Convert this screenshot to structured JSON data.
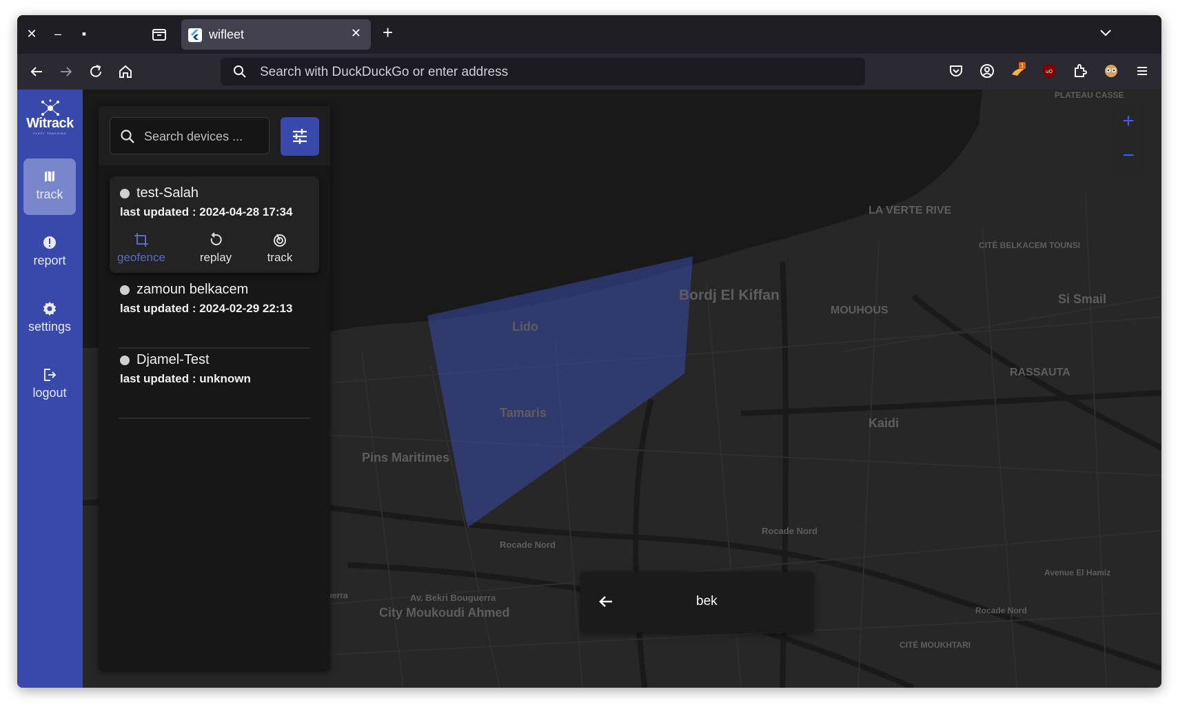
{
  "browser": {
    "tab_title": "wifleet",
    "url_placeholder": "Search with DuckDuckGo or enter address",
    "extension_badge": "1"
  },
  "sidebar": {
    "logo_word": "Witrack",
    "logo_tagline": "FLEET TRACKING",
    "items": [
      {
        "label": "track",
        "icon": "map-icon",
        "active": true
      },
      {
        "label": "report",
        "icon": "alert-circle-icon",
        "active": false
      },
      {
        "label": "settings",
        "icon": "gear-icon",
        "active": false
      },
      {
        "label": "logout",
        "icon": "logout-icon",
        "active": false
      }
    ]
  },
  "search": {
    "placeholder": "Search devices ..."
  },
  "devices": [
    {
      "name": "test-Salah",
      "updated_label": "last updated : ",
      "updated_value": "2024-04-28 17:34"
    },
    {
      "name": "zamoun belkacem",
      "updated_label": "last updated : ",
      "updated_value": "2024-02-29 22:13"
    },
    {
      "name": "Djamel-Test",
      "updated_label": "last updated : ",
      "updated_value": "unknown"
    }
  ],
  "device_actions": [
    {
      "label": "geofence",
      "icon": "crop-icon",
      "color": "#5c6bc0"
    },
    {
      "label": "replay",
      "icon": "replay-icon",
      "color": "#e0e0e0"
    },
    {
      "label": "track",
      "icon": "radar-icon",
      "color": "#e0e0e0"
    }
  ],
  "map": {
    "labels": [
      "LA VERTE RIVE",
      "CITÉ BELKACEM TOUNSI",
      "Bordj El Kiffan",
      "MOUHOUS",
      "Si Smail",
      "Lido",
      "RASSAUTA",
      "Kaidi",
      "Tamaris",
      "Pins Maritimes",
      "Rocade Nord",
      "Rocade Nord",
      "Av. Bekri Bouguerra",
      "City Moukoudi Ahmed",
      "Avenue El Hamiz",
      "Rocade Nord",
      "CITÉ MOUKHTARI",
      "PLATEAU CASSE",
      "uguerra"
    ],
    "zoom_in": "+",
    "zoom_out": "−"
  },
  "toast": {
    "text": "bek"
  },
  "colors": {
    "accent": "#3949ab",
    "geofence": "#3a4aa8"
  }
}
